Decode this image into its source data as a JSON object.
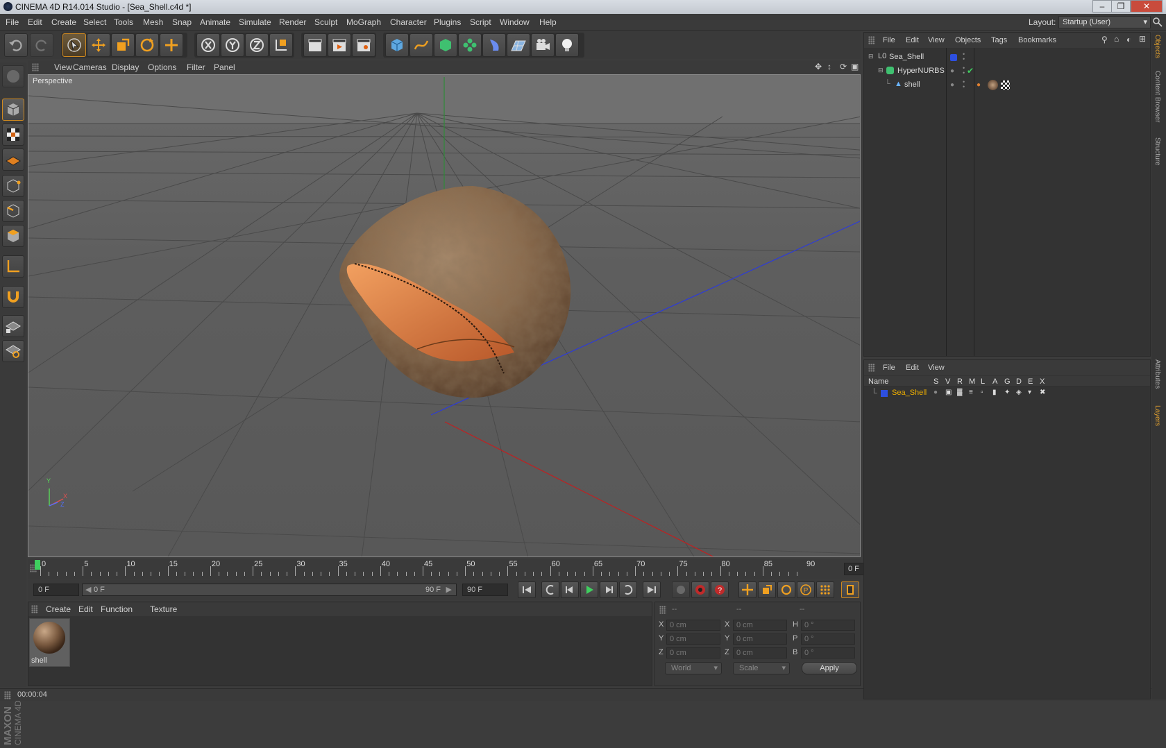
{
  "window": {
    "title": "CINEMA 4D R14.014 Studio - [Sea_Shell.c4d *]"
  },
  "menubar": {
    "items": [
      "File",
      "Edit",
      "Create",
      "Select",
      "Tools",
      "Mesh",
      "Snap",
      "Animate",
      "Simulate",
      "Render",
      "Sculpt",
      "MoGraph",
      "Character",
      "Plugins",
      "Script",
      "Window",
      "Help"
    ],
    "layout_label": "Layout:",
    "layout_value": "Startup (User)"
  },
  "viewport": {
    "menu": [
      "View",
      "Cameras",
      "Display",
      "Options",
      "Filter",
      "Panel"
    ],
    "camera_label": "Perspective",
    "axis": {
      "x": "X",
      "y": "Y",
      "z": "Z"
    }
  },
  "timeline": {
    "ticks": [
      "0",
      "5",
      "10",
      "15",
      "20",
      "25",
      "30",
      "35",
      "40",
      "45",
      "50",
      "55",
      "60",
      "65",
      "70",
      "75",
      "80",
      "85",
      "90"
    ],
    "current_frame": "0 F"
  },
  "transport": {
    "start": "0 F",
    "range_start": "0 F",
    "range_end": "90 F",
    "end": "90 F"
  },
  "materials": {
    "menu": [
      "Create",
      "Edit",
      "Function",
      "Texture"
    ],
    "items": [
      {
        "name": "shell"
      }
    ]
  },
  "coordinates": {
    "headers": [
      "--",
      "--",
      "--"
    ],
    "rows": [
      {
        "pos_label": "X",
        "pos": "0 cm",
        "size_label": "X",
        "size": "0 cm",
        "rot_label": "H",
        "rot": "0 °"
      },
      {
        "pos_label": "Y",
        "pos": "0 cm",
        "size_label": "Y",
        "size": "0 cm",
        "rot_label": "P",
        "rot": "0 °"
      },
      {
        "pos_label": "Z",
        "pos": "0 cm",
        "size_label": "Z",
        "size": "0 cm",
        "rot_label": "B",
        "rot": "0 °"
      }
    ],
    "mode": "World",
    "transform": "Scale",
    "apply": "Apply"
  },
  "objects": {
    "menu": [
      "File",
      "Edit",
      "View",
      "Objects",
      "Tags",
      "Bookmarks"
    ],
    "tree": [
      {
        "name": "Sea_Shell"
      },
      {
        "name": "HyperNURBS"
      },
      {
        "name": "shell"
      }
    ]
  },
  "layers": {
    "menu": [
      "File",
      "Edit",
      "View"
    ],
    "columns": {
      "name": "Name",
      "flags": [
        "S",
        "V",
        "R",
        "M",
        "L",
        "A",
        "G",
        "D",
        "E",
        "X"
      ]
    },
    "rows": [
      {
        "name": "Sea_Shell",
        "color": "#2d4fe0"
      }
    ]
  },
  "right_tabs": [
    "Objects",
    "Content Browser",
    "Structure",
    "Attributes",
    "Layers"
  ],
  "status": {
    "time": "00:00:04"
  },
  "colors": {
    "accent": "#d08a20",
    "bg": "#3a3a3a",
    "layer_name": "#f0b000"
  }
}
